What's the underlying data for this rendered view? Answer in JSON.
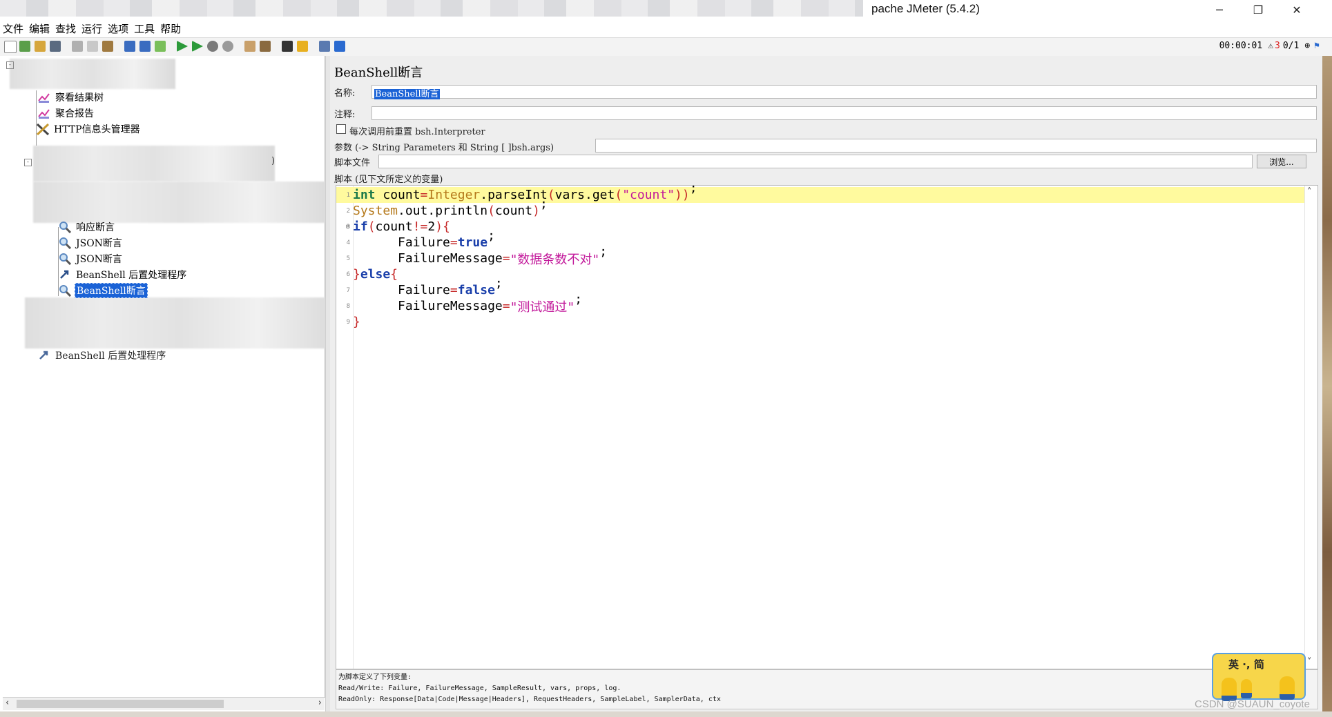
{
  "window": {
    "title": "pache JMeter (5.4.2)",
    "minimize": "─",
    "restore": "❐",
    "close": "✕"
  },
  "menu": [
    "文件",
    "编辑",
    "查找",
    "运行",
    "选项",
    "工具",
    "帮助"
  ],
  "toolbar": {
    "timer": "00:00:01",
    "warnings": "3",
    "threads": "0/1"
  },
  "tree": {
    "items": [
      {
        "label": "察看结果树",
        "icon": "view-results-tree-icon"
      },
      {
        "label": "聚合报告",
        "icon": "aggregate-report-icon"
      },
      {
        "label": "HTTP信息头管理器",
        "icon": "header-manager-icon"
      },
      {
        "label": "响应断言",
        "icon": "assertion-icon"
      },
      {
        "label": "JSON断言",
        "icon": "magnifier-icon"
      },
      {
        "label": "JSON断言",
        "icon": "magnifier-icon"
      },
      {
        "label": "BeanShell 后置处理程序",
        "icon": "postprocessor-icon"
      },
      {
        "label": "BeanShell断言",
        "icon": "magnifier-icon",
        "selected": true
      },
      {
        "label": "BeanShell 后置处理程序",
        "icon": "postprocessor-icon"
      }
    ],
    "partial_paren": ")"
  },
  "editor": {
    "title": "BeanShell断言",
    "name_label": "名称:",
    "name_value": "BeanShell断言",
    "comment_label": "注释:",
    "comment_value": "",
    "reset_label": "每次调用前重置 bsh.Interpreter",
    "reset_checked": false,
    "params_label": "参数 (-> String Parameters 和 String [ ]bsh.args)",
    "params_value": "",
    "script_file_label": "脚本文件",
    "script_file_value": "",
    "browse_label": "浏览...",
    "script_label": "脚本 (见下文所定义的变量)",
    "code_lines": [
      "int count=Integer.parseInt(vars.get(\"count\"));",
      "System.out.println(count);",
      "if(count!=2){",
      "      Failure=true;",
      "      FailureMessage=\"数据条数不对\";",
      "}else{",
      "      Failure=false;",
      "      FailureMessage=\"测试通过\";",
      "}"
    ],
    "line_numbers": [
      "1",
      "2",
      "3",
      "4",
      "5",
      "6",
      "7",
      "8",
      "9"
    ],
    "help": {
      "line1": "为脚本定义了下列变量:",
      "line2": "Read/Write: Failure, FailureMessage, SampleResult, vars, props, log.",
      "line3": "ReadOnly: Response[Data|Code|Message|Headers], RequestHeaders, SampleLabel, SamplerData, ctx"
    }
  },
  "ime": {
    "text": "英 ·, 简"
  },
  "watermark": "CSDN @SUAUN_coyote"
}
